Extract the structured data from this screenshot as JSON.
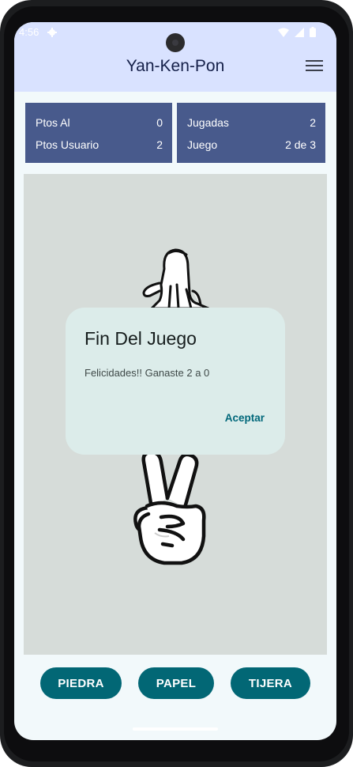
{
  "status_bar": {
    "time": "4:56",
    "icons": [
      "settings-icon",
      "wifi-icon",
      "signal-icon",
      "battery-icon"
    ]
  },
  "app_bar": {
    "title": "Yan-Ken-Pon",
    "menu_icon": "hamburger-menu-icon"
  },
  "scoreboard": {
    "left": [
      {
        "label": "Ptos Al",
        "value": "0"
      },
      {
        "label": "Ptos Usuario",
        "value": "2"
      }
    ],
    "right": [
      {
        "label": "Jugadas",
        "value": "2"
      },
      {
        "label": "Juego",
        "value": "2 de 3"
      }
    ]
  },
  "stage": {
    "ai_hand": "open-hand-paper-icon",
    "user_hand": "victory-hand-scissors-icon"
  },
  "dialog": {
    "title": "Fin Del Juego",
    "message": "Felicidades!! Ganaste 2 a 0",
    "confirm_label": "Aceptar"
  },
  "choices": {
    "rock_label": "PIEDRA",
    "paper_label": "PAPEL",
    "scissors_label": "TIJERA"
  },
  "colors": {
    "app_bar": "#d9e2ff",
    "score_box": "#485a8c",
    "stage": "#d6dcd9",
    "dialog": "#dcecea",
    "button": "#026775",
    "accent_text": "#00677a"
  }
}
